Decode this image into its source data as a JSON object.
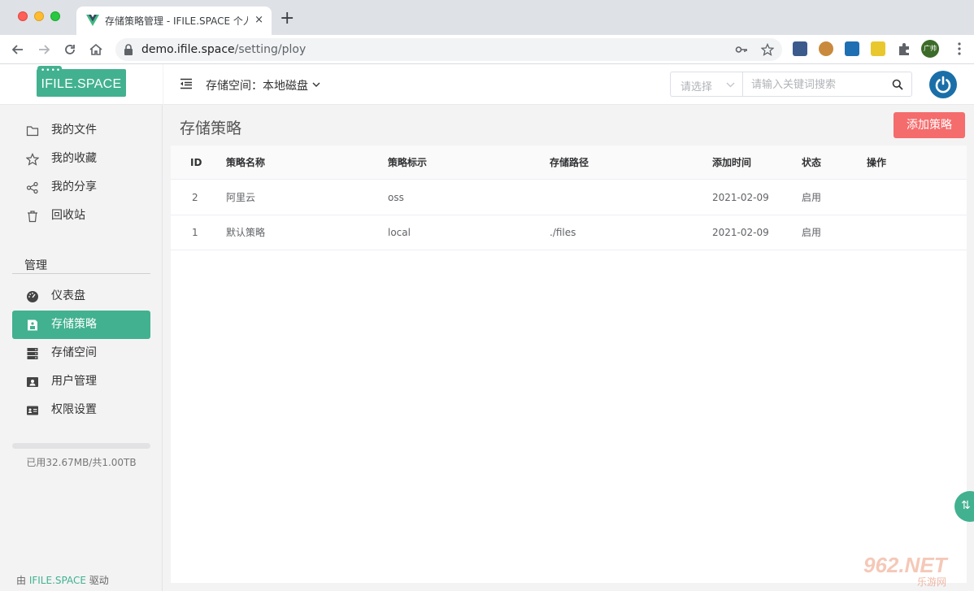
{
  "browser": {
    "tab_title": "存储策略管理 - IFILE.SPACE 个人",
    "tab_close": "×",
    "new_tab": "+",
    "url_host": "demo.ifile.space",
    "url_path": "/setting/ploy",
    "profile_initials": "广帅"
  },
  "brand": {
    "logo_dots": "••••",
    "logo_text": "IFILE.SPACE",
    "accent": "#42b18f",
    "danger": "#f56c6c"
  },
  "sidebar": {
    "items": [
      {
        "label": "我的文件",
        "icon": "folder-icon"
      },
      {
        "label": "我的收藏",
        "icon": "star-icon"
      },
      {
        "label": "我的分享",
        "icon": "share-icon"
      },
      {
        "label": "回收站",
        "icon": "trash-icon"
      }
    ],
    "group_title": "管理",
    "admin_items": [
      {
        "label": "仪表盘",
        "icon": "dashboard-icon"
      },
      {
        "label": "存储策略",
        "icon": "save-icon",
        "active": true
      },
      {
        "label": "存储空间",
        "icon": "server-icon"
      },
      {
        "label": "用户管理",
        "icon": "user-card-icon"
      },
      {
        "label": "权限设置",
        "icon": "id-card-icon"
      }
    ],
    "usage_fraction": 0.0,
    "usage_text": "已用32.67MB/共1.00TB",
    "powered_prefix": "由 ",
    "powered_brand": "IFILE.SPACE",
    "powered_suffix": " 驱动"
  },
  "header": {
    "space_label": "存储空间：本地磁盘",
    "select_placeholder": "请选择",
    "search_placeholder": "请输入关键词搜索"
  },
  "main": {
    "title": "存储策略",
    "add_button": "添加策略",
    "table": {
      "columns": [
        "ID",
        "策略名称",
        "策略标示",
        "存储路径",
        "添加时间",
        "状态",
        "操作"
      ],
      "rows": [
        [
          "2",
          "阿里云",
          "oss",
          "",
          "2021-02-09",
          "启用",
          ""
        ],
        [
          "1",
          "默认策略",
          "local",
          "./files",
          "2021-02-09",
          "启用",
          ""
        ]
      ]
    }
  },
  "float_button": "⇅"
}
